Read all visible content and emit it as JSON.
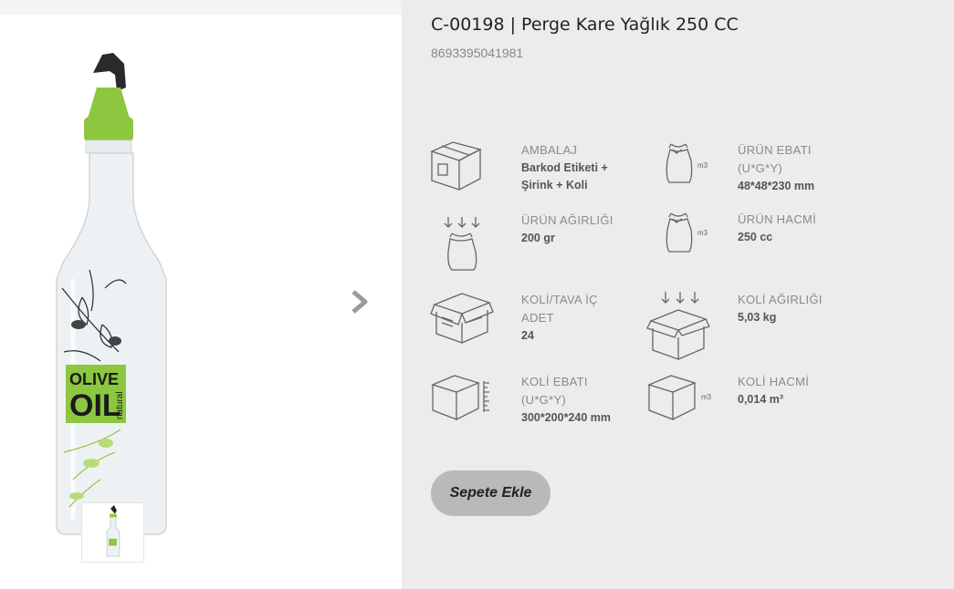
{
  "product": {
    "title": "C-00198 | Perge Kare Yağlık 250 CC",
    "barcode": "8693395041981",
    "image_alt": "Perge Kare Yağlık",
    "bottle_print": {
      "line1": "OLIVE",
      "line2": "OIL",
      "side": "natural"
    }
  },
  "specs": [
    {
      "icon": "package-box-icon",
      "label": "AMBALAJ",
      "value_lines": [
        "Barkod Etiketi +",
        "Şirink + Koli"
      ]
    },
    {
      "icon": "bag-volume-icon",
      "label": "ÜRÜN EBATI\n(U*G*Y)",
      "value_lines": [
        "48*48*230 mm"
      ]
    },
    {
      "icon": "weight-bag-icon",
      "label": "ÜRÜN AĞIRLIĞI",
      "value_lines": [
        "200 gr"
      ]
    },
    {
      "icon": "bag-volume-icon",
      "label": "ÜRÜN HACMİ",
      "value_lines": [
        "250 cc"
      ]
    },
    {
      "icon": "open-box-icon",
      "label": "KOLİ/TAVA İÇ\nADET",
      "value_lines": [
        "24"
      ]
    },
    {
      "icon": "box-weight-icon",
      "label": "KOLİ AĞIRLIĞI",
      "value_lines": [
        "5,03 kg"
      ]
    },
    {
      "icon": "box-ruler-icon",
      "label": "KOLİ EBATI\n(U*G*Y)",
      "value_lines": [
        "300*200*240 mm"
      ]
    },
    {
      "icon": "box-volume-icon",
      "label": "KOLİ HACMİ",
      "value_lines": [
        "0,014 m³"
      ]
    }
  ],
  "icon_text": {
    "m3": "m3"
  },
  "actions": {
    "add_to_cart": "Sepete Ekle"
  },
  "colors": {
    "accent_green": "#8dc63f",
    "button_gray": "#b9b9b9",
    "panel_bg": "#ececec"
  }
}
